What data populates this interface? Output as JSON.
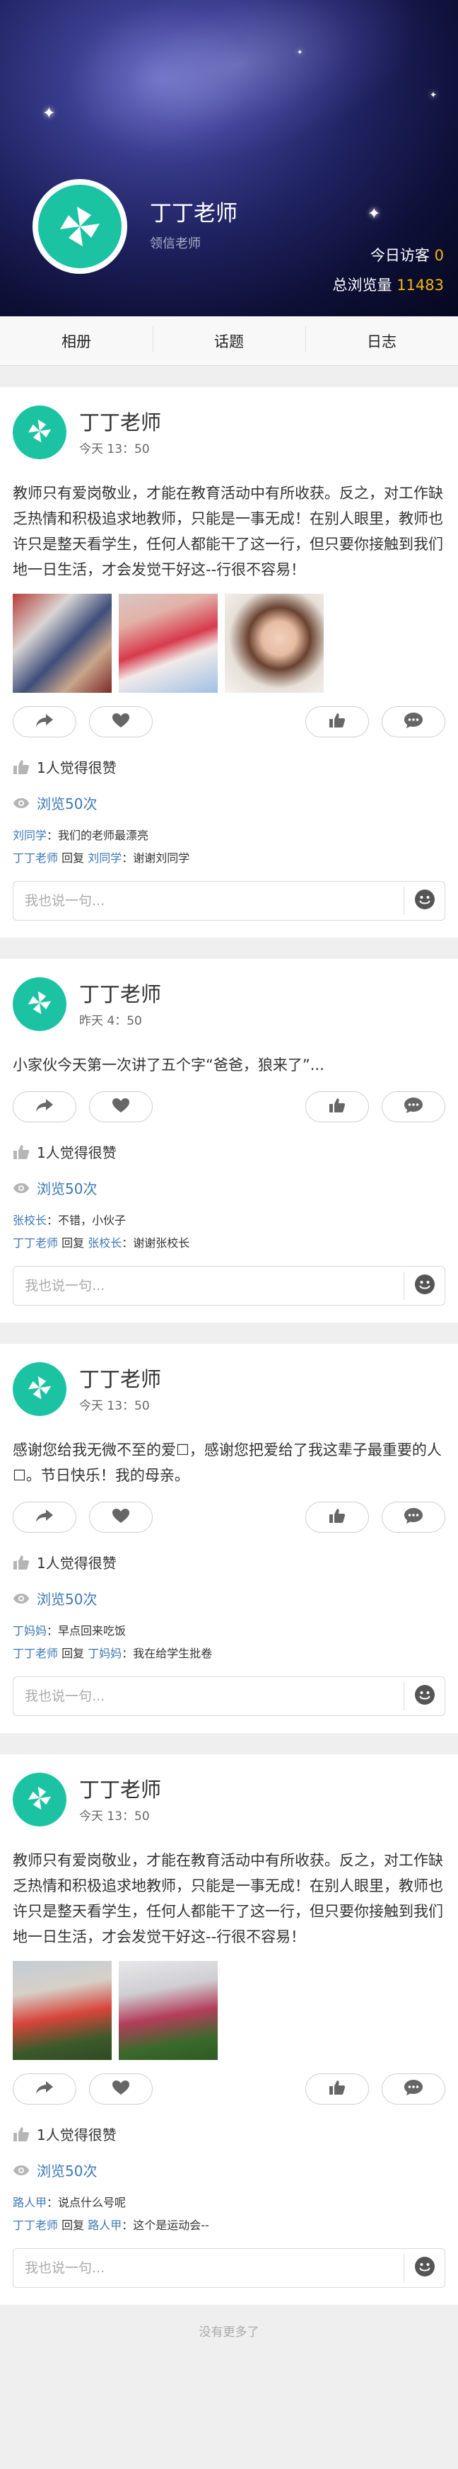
{
  "header": {
    "name": "丁丁老师",
    "role": "领信老师",
    "visitors_label": "今日访客",
    "visitors_value": "0",
    "views_label": "总浏览量",
    "views_value": "11483"
  },
  "tabs": [
    "相册",
    "话题",
    "日志"
  ],
  "posts": [
    {
      "author": "丁丁老师",
      "time": "今天 13：50",
      "text": "教师只有爱岗敬业，才能在教育活动中有所收获。反之，对工作缺乏热情和积极追求地教师，只能是一事无成！在别人眼里，教师也许只是整天看学生，任何人都能干了这一行，但只要你接触到我们地一日生活，才会发觉干好这--行很不容易！",
      "likes": "1人觉得很赞",
      "views": "浏览50次",
      "comments": [
        {
          "name": "刘同学",
          "text": "我们的老师最漂亮"
        },
        {
          "name": "丁丁老师",
          "reply_word": "回复",
          "to": "刘同学",
          "text": "谢谢刘同学"
        }
      ],
      "placeholder": "我也说一句..."
    },
    {
      "author": "丁丁老师",
      "time": "昨天 4：50",
      "text": "小家伙今天第一次讲了五个字“爸爸，狼来了”...",
      "likes": "1人觉得很赞",
      "views": "浏览50次",
      "comments": [
        {
          "name": "张校长",
          "text": "不错，小伙子"
        },
        {
          "name": "丁丁老师",
          "reply_word": "回复",
          "to": "张校长",
          "text": "谢谢张校长"
        }
      ],
      "placeholder": "我也说一句..."
    },
    {
      "author": "丁丁老师",
      "time": "今天 13：50",
      "text": "感谢您给我无微不至的爱\u0000，感谢您把爱给了我这辈子最重要的人\u0000。节日快乐！我的母亲。",
      "likes": "1人觉得很赞",
      "views": "浏览50次",
      "comments": [
        {
          "name": "丁妈妈",
          "text": "早点回来吃饭"
        },
        {
          "name": "丁丁老师",
          "reply_word": "回复",
          "to": "丁妈妈",
          "text": "我在给学生批卷"
        }
      ],
      "placeholder": "我也说一句..."
    },
    {
      "author": "丁丁老师",
      "time": "今天 13：50",
      "text": "教师只有爱岗敬业，才能在教育活动中有所收获。反之，对工作缺乏热情和积极追求地教师，只能是一事无成！在别人眼里，教师也许只是整天看学生，任何人都能干了这一行，但只要你接触到我们地一日生活，才会发觉干好这--行很不容易！",
      "likes": "1人觉得很赞",
      "views": "浏览50次",
      "comments": [
        {
          "name": "路人甲",
          "text": "说点什么号呢"
        },
        {
          "name": "丁丁老师",
          "reply_word": "回复",
          "to": "路人甲",
          "text": "这个是运动会--"
        }
      ],
      "placeholder": "我也说一句..."
    }
  ],
  "footer": {
    "no_more": "没有更多了"
  },
  "colors": {
    "accent_teal": "#1cc3a2",
    "link_blue": "#3c78b5",
    "highlight_yellow": "#f5b800"
  },
  "icons": [
    "pinwheel-logo-icon",
    "share-icon",
    "heart-icon",
    "thumbs-up-icon",
    "chat-bubble-icon",
    "eye-icon",
    "smiley-icon"
  ]
}
